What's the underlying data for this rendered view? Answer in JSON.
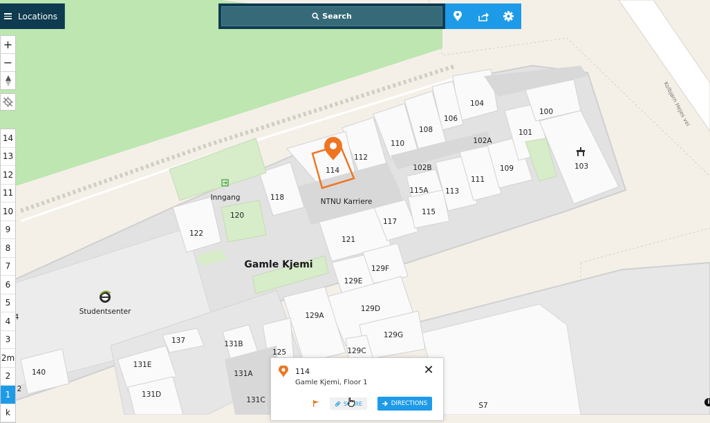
{
  "header": {
    "locations_label": "Locations",
    "search_label": "Search"
  },
  "toolbar": {
    "icons": [
      "map-pin-icon",
      "share-icon",
      "settings-gear-icon"
    ]
  },
  "zoom_controls": {
    "zoom_in": "+",
    "zoom_out": "−",
    "compass": "north-arrow-icon"
  },
  "floors": {
    "items": [
      "14",
      "13",
      "12",
      "11",
      "10",
      "9",
      "8",
      "7",
      "6",
      "5",
      "4",
      "3",
      "2m",
      "2",
      "1",
      "k"
    ],
    "selected": "1"
  },
  "map": {
    "building_name": "Gamle Kjemi",
    "road_name": "Kolbjørn Hejes vei",
    "entrance_label": "Inngang",
    "poi_labels": {
      "ntnu_karriere": "NTNU Karriere",
      "studentsenter": "Studentsenter"
    },
    "rooms": {
      "r100": "100",
      "r101": "101",
      "r102a": "102A",
      "r102b": "102B",
      "r103": "103",
      "r104": "104",
      "r106": "106",
      "r108": "108",
      "r109": "109",
      "r110": "110",
      "r111": "111",
      "r112": "112",
      "r113": "113",
      "r114": "114",
      "r115": "115",
      "r115a": "115A",
      "r117": "117",
      "r118": "118",
      "r120": "120",
      "r121": "121",
      "r122": "122",
      "r129a": "129A",
      "r129c": "129C",
      "r129d": "129D",
      "r129e": "129E",
      "r129f": "129F",
      "r129g": "129G",
      "r131a": "131A",
      "r131b": "131B",
      "r131c": "131C",
      "r131d": "131D",
      "r131e": "131E",
      "r137": "137",
      "r140": "140",
      "r125": "125",
      "s7": "S7",
      "edge4": "4",
      "edge2": "2"
    },
    "selected_room": "114",
    "colors": {
      "background": "#f4f0e8",
      "park": "#bde6b0",
      "building": "#e4e4e4",
      "room": "#fafafa",
      "corridor": "#e8e8e8",
      "highlight": "#ee7623",
      "accent": "#1e9be8",
      "header": "#0e3b4f"
    }
  },
  "popup": {
    "title": "114",
    "subtitle": "Gamle Kjemi, Floor 1",
    "share_label": "SHARE",
    "directions_label": "DIRECTIONS"
  },
  "footer": {
    "info_icon": "i"
  }
}
